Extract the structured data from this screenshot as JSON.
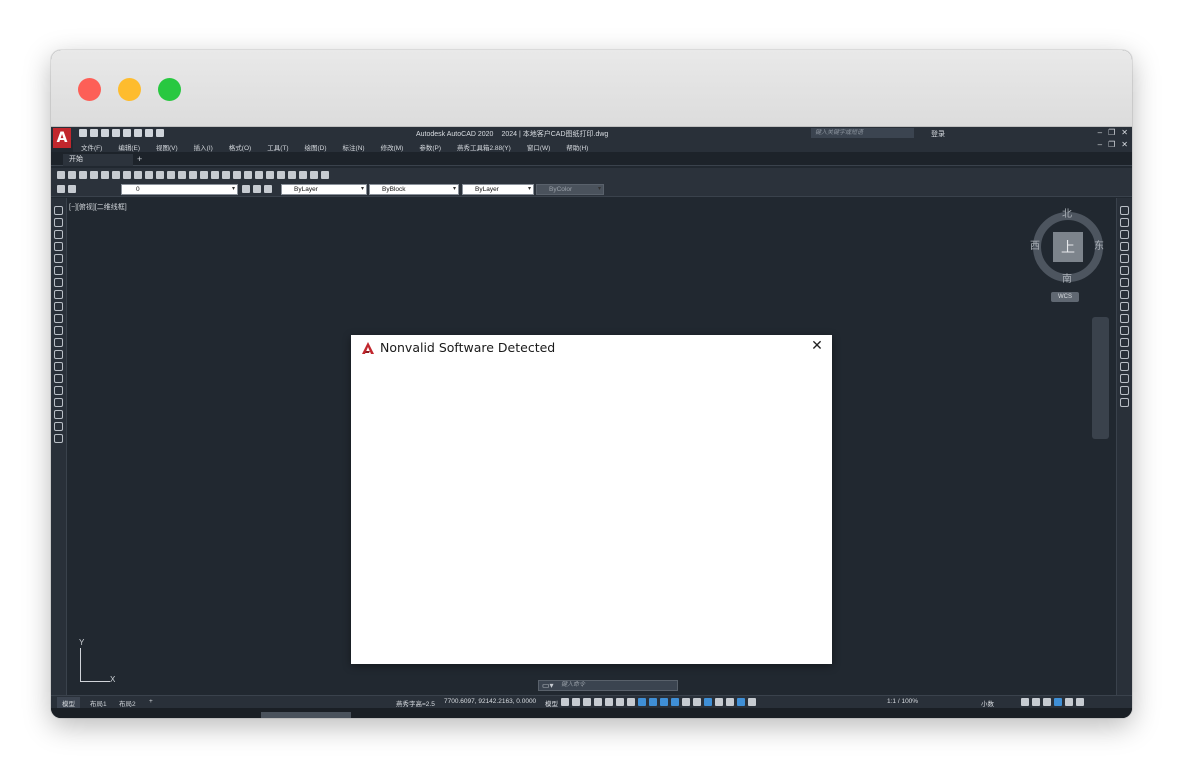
{
  "app": {
    "logo_letter": "A",
    "title": "Autodesk AutoCAD 2020",
    "filename": "2024 | 本地客户CAD图纸打印.dwg",
    "search_placeholder": "键入关键字或短语",
    "login": "登录"
  },
  "menu": [
    "文件(F)",
    "编辑(E)",
    "视图(V)",
    "插入(I)",
    "格式(O)",
    "工具(T)",
    "绘图(D)",
    "标注(N)",
    "修改(M)",
    "参数(P)",
    "燕秀工具箱2.88(Y)",
    "窗口(W)",
    "帮助(H)"
  ],
  "tabs": {
    "start": "开始",
    "add": "+"
  },
  "properties": {
    "layer": "0",
    "color": "ByLayer",
    "linetype": "ByBlock",
    "lineweight": "ByLayer",
    "plotstyle": "ByColor"
  },
  "viewport": {
    "label": "[−][俯视][二维线框]",
    "compass": {
      "north": "北",
      "south": "南",
      "east": "东",
      "west": "西",
      "top": "上"
    },
    "wcs": "WCS",
    "ucs_x": "X",
    "ucs_y": "Y"
  },
  "command": {
    "placeholder": "键入命令"
  },
  "status": {
    "tabs": [
      "模型",
      "布局1",
      "布局2"
    ],
    "add_tab": "+",
    "font_height": "燕秀字高=2.5",
    "coords": "7700.6097, 92142.2163, 0.0000",
    "mode": "模型",
    "scale": "1:1 / 100%",
    "units": "小数"
  },
  "dialog": {
    "title": "Nonvalid Software Detected",
    "close": "✕"
  },
  "colors": {
    "accent": "#3f8fd6",
    "autodesk_red": "#c1272d",
    "canvas": "#212830"
  }
}
